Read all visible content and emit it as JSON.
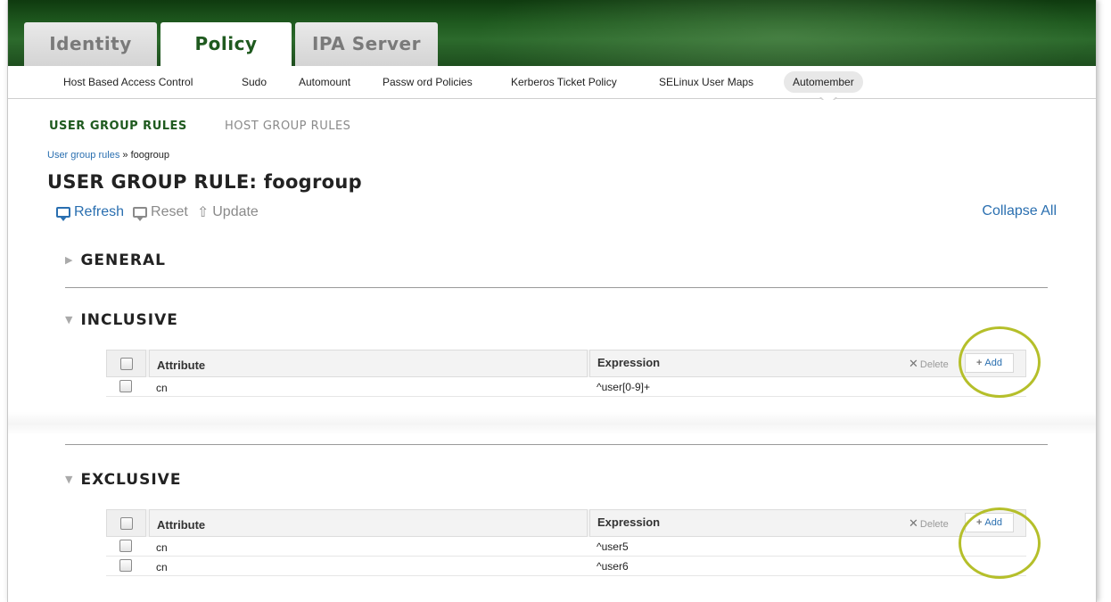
{
  "top_tabs": [
    {
      "label": "Identity",
      "active": false
    },
    {
      "label": "Policy",
      "active": true
    },
    {
      "label": "IPA Server",
      "active": false
    }
  ],
  "subnav": [
    {
      "label": "Host Based Access Control",
      "selected": false
    },
    {
      "label": "Sudo",
      "selected": false
    },
    {
      "label": "Automount",
      "selected": false
    },
    {
      "label": "Passw ord Policies",
      "selected": false
    },
    {
      "label": "Kerberos Ticket Policy",
      "selected": false
    },
    {
      "label": "SELinux User Maps",
      "selected": false
    },
    {
      "label": "Automember",
      "selected": true
    }
  ],
  "facet_tabs": {
    "user_group_rules": "USER GROUP RULES",
    "host_group_rules": "HOST GROUP RULES"
  },
  "breadcrumb": {
    "link": "User group rules",
    "separator": " » ",
    "current": "foogroup"
  },
  "page_title": {
    "prefix": "USER GROUP RULE: ",
    "name": "foogroup"
  },
  "actions": {
    "refresh": "Refresh",
    "reset": "Reset",
    "update": "Update",
    "collapse_all": "Collapse All"
  },
  "sections": {
    "general": {
      "title": "GENERAL",
      "expanded": false
    },
    "inclusive": {
      "title": "INCLUSIVE",
      "expanded": true,
      "columns": {
        "attribute": "Attribute",
        "expression": "Expression"
      },
      "delete_label": "Delete",
      "add_label": "Add",
      "rows": [
        {
          "attribute": "cn",
          "expression": "^user[0-9]+"
        }
      ]
    },
    "exclusive": {
      "title": "EXCLUSIVE",
      "expanded": true,
      "columns": {
        "attribute": "Attribute",
        "expression": "Expression"
      },
      "delete_label": "Delete",
      "add_label": "Add",
      "rows": [
        {
          "attribute": "cn",
          "expression": "^user5"
        },
        {
          "attribute": "cn",
          "expression": "^user6"
        }
      ]
    }
  },
  "colors": {
    "brand_green": "#1f5a1f",
    "link_blue": "#2a6fb0",
    "highlight_circle": "#b5bf2a"
  }
}
